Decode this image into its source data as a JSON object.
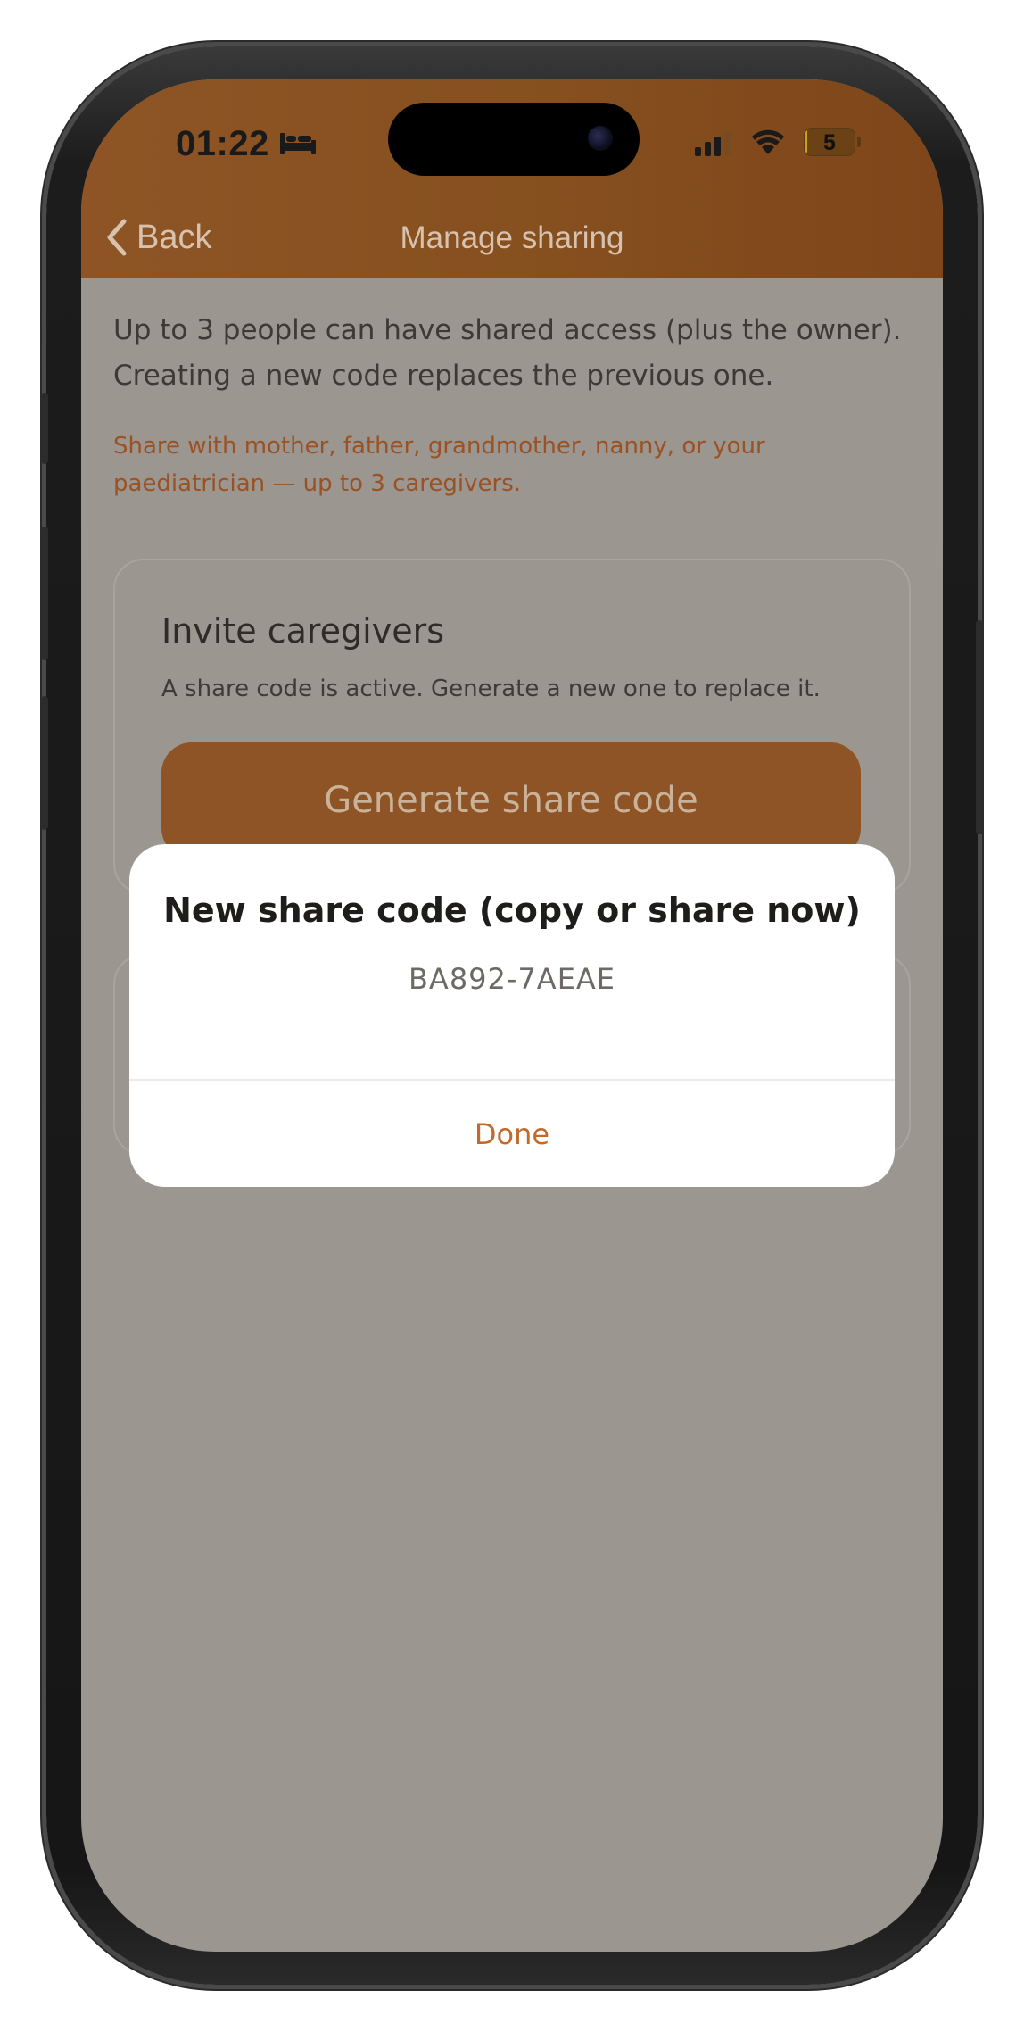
{
  "status_bar": {
    "time": "01:22",
    "sleep_icon": "bed-icon",
    "signal_icon": "cellular-signal-icon",
    "wifi_icon": "wifi-icon",
    "battery_level": "5",
    "battery_fraction": 0.05
  },
  "nav": {
    "back_label": "Back",
    "title": "Manage sharing"
  },
  "intro": {
    "text": "Up to 3 people can have shared access (plus the owner). Creating a new code replaces the previous one.",
    "hint": "Share with mother, father, grandmother, nanny, or your paediatrician — up to 3 caregivers."
  },
  "invite_card": {
    "title": "Invite caregivers",
    "description": "A share code is active. Generate a new one to replace it.",
    "button_label": "Generate share code"
  },
  "dialog": {
    "title": "New share code (copy or share now)",
    "code": "BA892-7AEAE",
    "done_label": "Done"
  },
  "colors": {
    "header_brown": "#8e5425",
    "accent_orange": "#c26a2c",
    "overlay_gray": "#9b9690"
  }
}
